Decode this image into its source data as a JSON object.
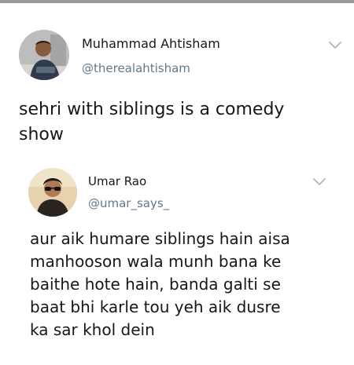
{
  "tweets": [
    {
      "author_name": "Muhammad Ahtisham",
      "author_handle": "@therealahtisham",
      "text_lines": [
        "sehri with siblings is a comedy",
        "show"
      ],
      "avatar_icon": "user-avatar-photo",
      "menu_icon": "chevron-down-icon"
    },
    {
      "author_name": "Umar Rao",
      "author_handle": "@umar_says_",
      "text_lines": [
        "aur aik humare siblings hain aisa",
        "manhooson wala munh bana ke",
        "baithe hote hain, banda galti se",
        "baat bhi karle tou yeh aik dusre",
        "ka sar khol dein"
      ],
      "avatar_icon": "user-avatar-photo",
      "menu_icon": "chevron-down-icon"
    }
  ],
  "colors": {
    "text": "#14171a",
    "handle": "#657786",
    "chevron": "#aab8c2",
    "top_strip": "#9a9a9a"
  }
}
